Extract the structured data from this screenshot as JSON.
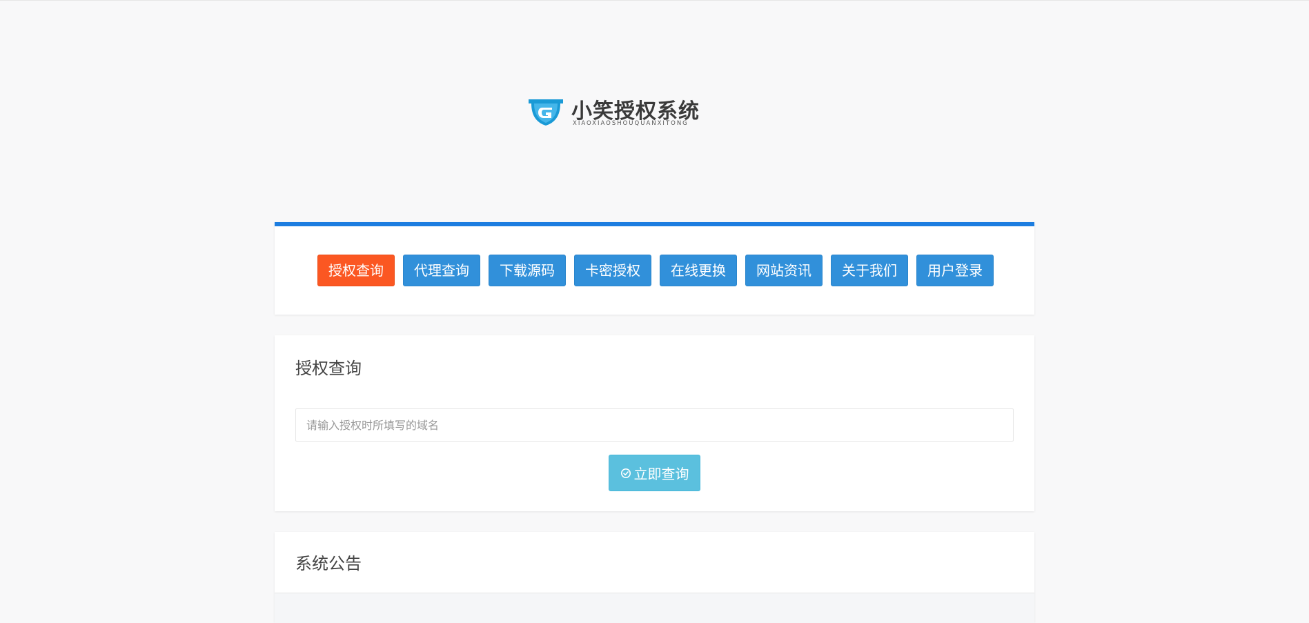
{
  "logo": {
    "title": "小笑授权系统",
    "subtitle": "XIAOXIAOSHOUQUANXITONG",
    "icon": "shield-g-icon",
    "brand_color": "#1a9ad6"
  },
  "nav": {
    "accent_color": "#1c7de0",
    "active_color": "#fb5722",
    "button_color": "#3190da",
    "items": [
      {
        "label": "授权查询",
        "active": true
      },
      {
        "label": "代理查询"
      },
      {
        "label": "下载源码"
      },
      {
        "label": "卡密授权"
      },
      {
        "label": "在线更换"
      },
      {
        "label": "网站资讯"
      },
      {
        "label": "关于我们"
      },
      {
        "label": "用户登录"
      }
    ]
  },
  "query": {
    "title": "授权查询",
    "input_placeholder": "请输入授权时所填写的域名",
    "input_value": "",
    "button_label": "立即查询",
    "button_icon": "check-circle-icon",
    "button_color": "#5bc0de"
  },
  "notice": {
    "title": "系统公告"
  }
}
